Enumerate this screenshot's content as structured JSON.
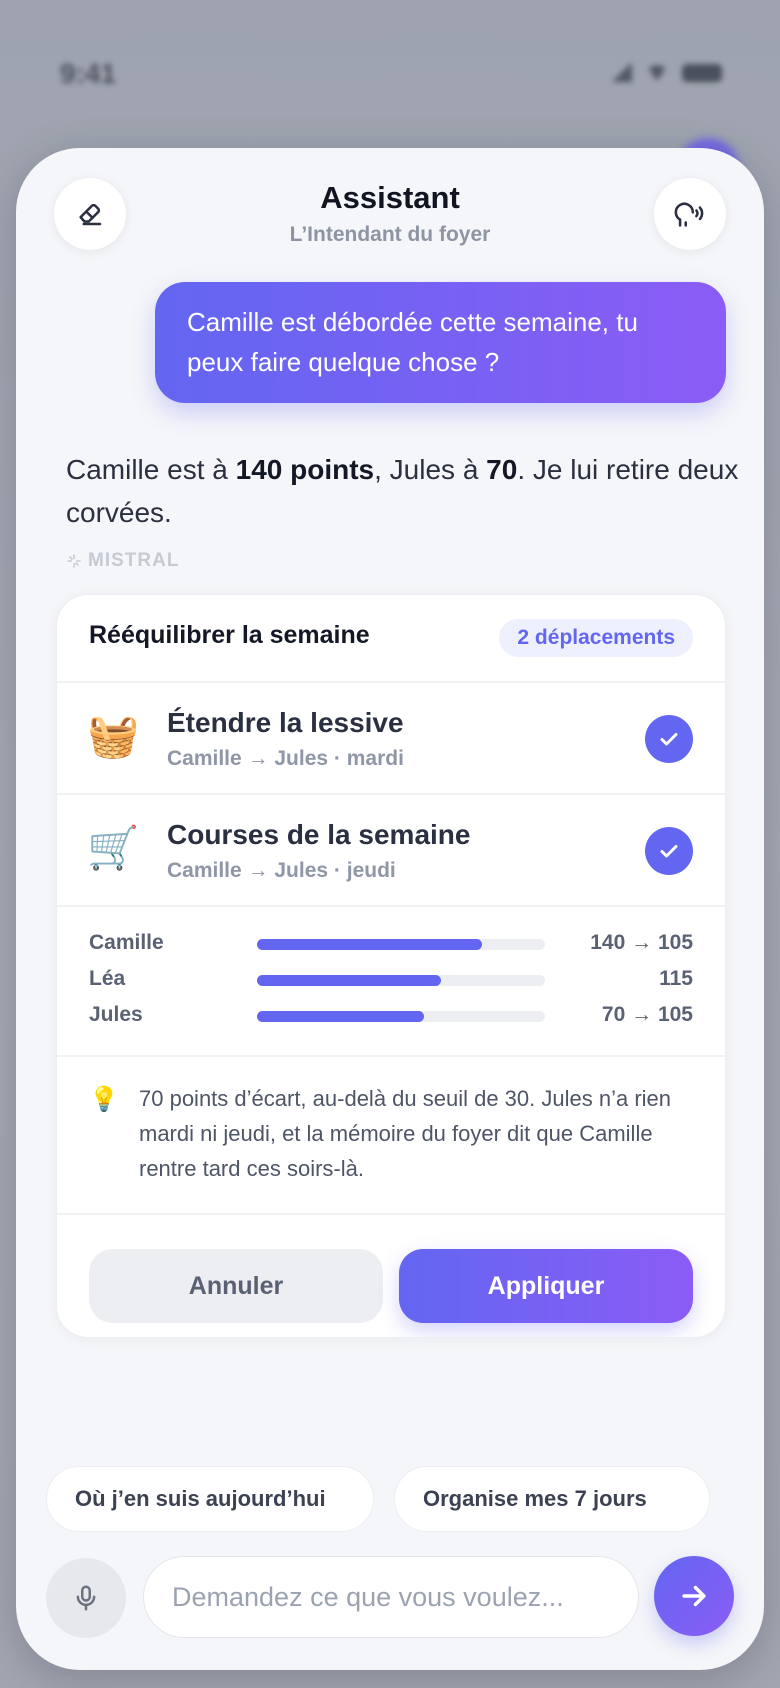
{
  "status_bar": {
    "time": "9:41"
  },
  "header": {
    "title": "Assistant",
    "subtitle": "L’Intendant du foyer",
    "erase_icon": "eraser-icon",
    "voice_icon": "voice-icon"
  },
  "conversation": {
    "user_message": "Camille est débordée cette semaine, tu peux faire quelque chose ?",
    "reply": {
      "part1": "Camille est à ",
      "points_camille": "140 points",
      "part2": ", Jules à ",
      "points_jules": "70",
      "part3": ". Je lui retire deux corvées."
    },
    "model_label": "MISTRAL"
  },
  "proposal": {
    "title": "Rééquilibrer la semaine",
    "badge": "2 déplacements",
    "tasks": [
      {
        "emoji": "🧺",
        "name": "Étendre la lessive",
        "meta": "Camille → Jules · mardi",
        "checked": true
      },
      {
        "emoji": "🛒",
        "name": "Courses de la semaine",
        "meta": "Camille → Jules · jeudi",
        "checked": true
      }
    ],
    "balance": [
      {
        "name": "Camille",
        "value_text": "140 → 105",
        "fill": 0.78
      },
      {
        "name": "Léa",
        "value_text": "115",
        "fill": 0.64
      },
      {
        "name": "Jules",
        "value_text": "70 → 105",
        "fill": 0.58
      }
    ],
    "explanation": "70 points d’écart, au-delà du seuil de 30. Jules n’a rien mardi ni jeudi, et la mémoire du foyer dit que Camille rentre tard ces soirs-là.",
    "cancel_label": "Annuler",
    "apply_label": "Appliquer"
  },
  "suggestions": [
    "Où j’en suis aujourd’hui",
    "Organise mes 7 jours"
  ],
  "composer": {
    "placeholder": "Demandez ce que vous voulez...",
    "mic_icon": "microphone-icon",
    "send_icon": "send-arrow-icon"
  },
  "colors": {
    "accent": "#6366f1",
    "accent_end": "#8b5cf6"
  }
}
